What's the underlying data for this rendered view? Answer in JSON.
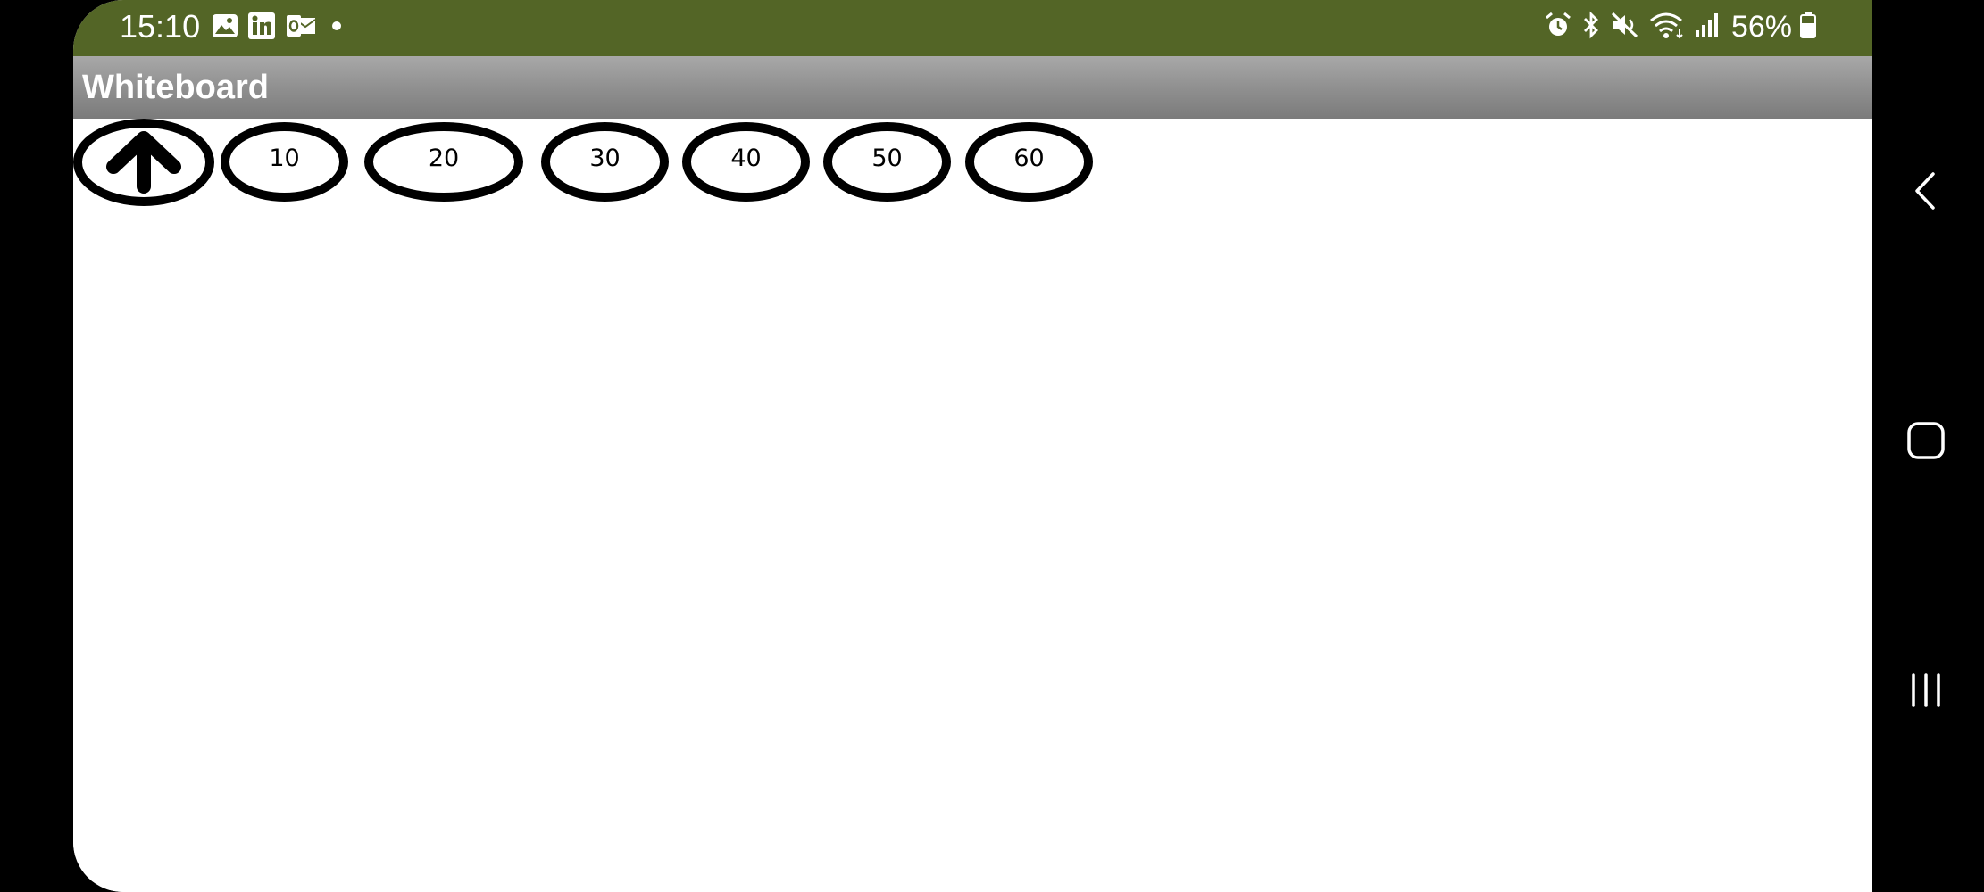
{
  "status_bar": {
    "time": "15:10",
    "battery": "56%",
    "left_icons": [
      "gallery-icon",
      "linkedin-icon",
      "outlook-icon",
      "dot-icon"
    ],
    "right_icons": [
      "alarm-icon",
      "bluetooth-icon",
      "mute-icon",
      "wifi-icon",
      "signal-icon",
      "battery-icon"
    ],
    "background_color": "#536526"
  },
  "app_bar": {
    "title": "Whiteboard"
  },
  "toolbar": {
    "up_button_icon": "arrow-up-icon",
    "size_buttons": [
      "10",
      "20",
      "30",
      "40",
      "50",
      "60"
    ]
  },
  "nav_bar": {
    "buttons": [
      "back-icon",
      "home-icon",
      "recents-icon"
    ]
  }
}
